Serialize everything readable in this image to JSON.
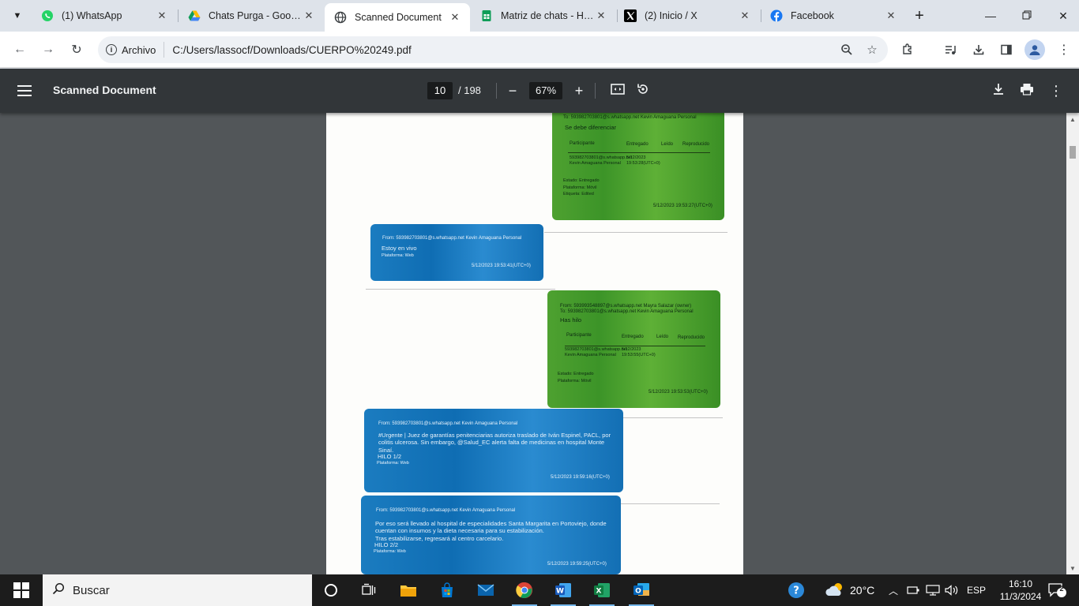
{
  "tabs": [
    {
      "title": "(1) WhatsApp",
      "favicon": "whatsapp-icon",
      "color": "#25d366"
    },
    {
      "title": "Chats Purga - Google Drive",
      "favicon": "google-drive-icon",
      "color": "#fbbc04"
    },
    {
      "title": "Scanned Document",
      "favicon": "globe-icon",
      "color": "#3c4043",
      "active": true
    },
    {
      "title": "Matriz de chats - Hojas de cálculo",
      "favicon": "sheets-icon",
      "color": "#0f9d58"
    },
    {
      "title": "(2) Inicio / X",
      "favicon": "x-icon",
      "color": "#000000"
    },
    {
      "title": "Facebook",
      "favicon": "facebook-icon",
      "color": "#1877f2"
    }
  ],
  "address": {
    "chip_label": "Archivo",
    "url": "C:/Users/lassocf/Downloads/CUERPO%20249.pdf"
  },
  "pdf": {
    "title": "Scanned Document",
    "current_page": "10",
    "total_pages": "/ 198",
    "zoom": "67%"
  },
  "messages": {
    "m1": {
      "header_line": "To: 593982703801@s.whatsapp.net Kevin Amaguana Personal",
      "body": "Se debe diferenciar",
      "th_participant": "Participante",
      "th_delivered": "Entregado",
      "th_read": "Leído",
      "th_played": "Reproducido",
      "row_participant": "593982703801@s.whatsapp.net Kevin Amaguana Personal",
      "row_delivered": "5/12/2023 19:53:28(UTC+0)",
      "state": "Estado: Entregado",
      "platform": "Plataforma: Móvil",
      "tag": "Etiqueta: Edited",
      "timestamp": "5/12/2023 19:53:27(UTC+0)"
    },
    "m2": {
      "from": "From: 593982703801@s.whatsapp.net Kevin Amaguana Personal",
      "body": "Estoy en vivo",
      "platform": "Plataforma: Web",
      "timestamp": "5/12/2023 19:53:41(UTC+0)"
    },
    "m3": {
      "from": "From: 593993548897@s.whatsapp.net Mayra Salazar (owner)",
      "to": "To: 593982703801@s.whatsapp.net Kevin Amaguana Personal",
      "body": "Has hilo",
      "th_participant": "Participante",
      "th_delivered": "Entregado",
      "th_read": "Leído",
      "th_played": "Reproducido",
      "row_participant": "593982703801@s.whatsapp.net Kevin Amaguana Personal",
      "row_delivered": "5/12/2023 19:53:55(UTC+0)",
      "state": "Estado: Entregado",
      "platform": "Plataforma: Móvil",
      "timestamp": "5/12/2023 19:53:53(UTC+0)"
    },
    "m4": {
      "from": "From: 593982703801@s.whatsapp.net Kevin Amaguana Personal",
      "body": "#Urgente | Juez de garantías penitenciarias autoriza traslado de Iván Espinel, PACL, por colitis ulcerosa. Sin embargo, @Salud_EC alerta falta de medicinas en hospital Monte Sinaí.",
      "thread": "HILO 1/2",
      "platform": "Plataforma: Web",
      "timestamp": "5/12/2023 19:59:16(UTC+0)"
    },
    "m5": {
      "from": "From: 593982703801@s.whatsapp.net Kevin Amaguana Personal",
      "body": "Por eso será llevado al hospital de especialidades Santa Margarita en Portoviejo, donde cuentan con insumos y la dieta necesaria para su estabilización.",
      "body2": "Tras estabilizarse, regresará al centro carcelario.",
      "thread": "HILO 2/2",
      "platform": "Plataforma: Web",
      "timestamp": "5/12/2023 19:59:25(UTC+0)"
    }
  },
  "taskbar": {
    "search_placeholder": "Buscar",
    "weather": "20°C",
    "language": "ESP",
    "time": "16:10",
    "date": "11/3/2024",
    "notifications": "2"
  }
}
